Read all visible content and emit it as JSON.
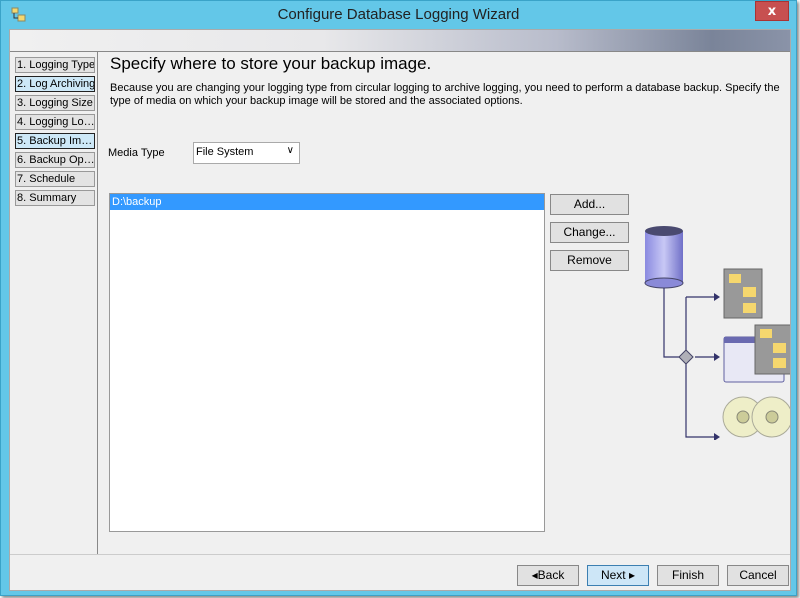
{
  "window": {
    "title": "Configure Database Logging Wizard",
    "close_label": "x"
  },
  "steps": [
    {
      "label": "1. Logging Type",
      "active": false
    },
    {
      "label": "2. Log Archiving",
      "active": true
    },
    {
      "label": "3. Logging Size",
      "active": false
    },
    {
      "label": "4. Logging Lo…",
      "active": false
    },
    {
      "label": "5. Backup Im…",
      "active": true
    },
    {
      "label": "6. Backup Op…",
      "active": false
    },
    {
      "label": "7. Schedule",
      "active": false
    },
    {
      "label": "8. Summary",
      "active": false
    }
  ],
  "page": {
    "heading": "Specify where to store your backup image.",
    "description": "Because you are changing your logging type from circular logging to archive logging, you need to perform a database backup. Specify the type of media on which your backup image will be stored and the associated options.",
    "media_type_label": "Media Type",
    "media_type_value": "File System",
    "locations": [
      "D:\\backup"
    ]
  },
  "side_buttons": {
    "add": "Add...",
    "change": "Change...",
    "remove": "Remove"
  },
  "footer": {
    "back": "Back",
    "next": "Next",
    "finish": "Finish",
    "cancel": "Cancel"
  }
}
